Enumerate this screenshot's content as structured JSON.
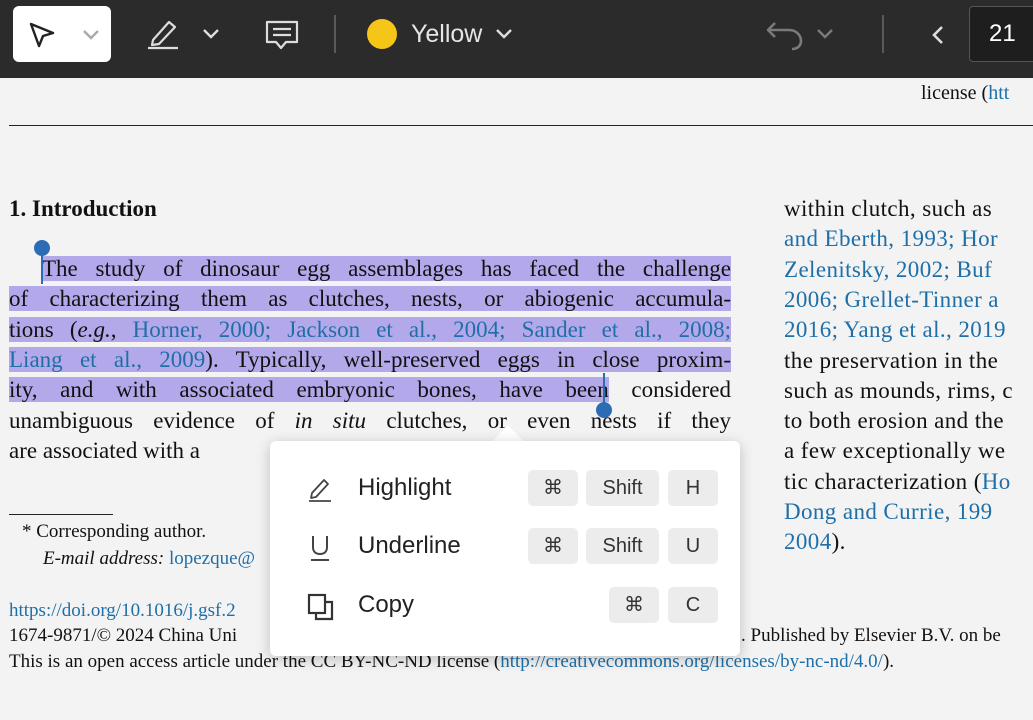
{
  "toolbar": {
    "color_label": "Yellow",
    "page_number": "21",
    "accent_color": "#f5c518"
  },
  "document": {
    "header_fragment_prefix": "license (",
    "header_fragment_link": "htt",
    "section_heading": "1. Introduction",
    "left_lines": [
      {
        "segments": [
          {
            "t": "The study of dinosaur egg assemblages has faced the challenge",
            "hl": true
          }
        ]
      },
      {
        "segments": [
          {
            "t": "of characterizing them as clutches, nests, or abiogenic accumula-",
            "hl": true
          }
        ]
      },
      {
        "segments": [
          {
            "t": "tions (",
            "hl": true
          },
          {
            "t": "e.g.",
            "hl": true,
            "i": true
          },
          {
            "t": ", ",
            "hl": true
          },
          {
            "t": "Horner, 2000; Jackson et al., 2004; Sander et al., 2008;",
            "hl": true,
            "link": true
          }
        ]
      },
      {
        "segments": [
          {
            "t": "Liang et al., 2009",
            "hl": true,
            "link": true
          },
          {
            "t": "). Typically, well-preserved eggs in close proxim-",
            "hl": true
          }
        ]
      },
      {
        "segments": [
          {
            "t": "ity, and with associated embryonic bones, have been",
            "hl": true
          },
          {
            "t": " considered"
          }
        ]
      },
      {
        "segments": [
          {
            "t": "unambiguous evidence of "
          },
          {
            "t": "in situ",
            "i": true
          },
          {
            "t": " clutches, or even nests if they"
          }
        ]
      },
      {
        "segments": [
          {
            "t": "are associated with a"
          }
        ]
      }
    ],
    "right_lines": [
      {
        "segments": [
          {
            "t": "within clutch, such as"
          }
        ]
      },
      {
        "segments": [
          {
            "t": "and Eberth, 1993; Hor",
            "link": true
          }
        ]
      },
      {
        "segments": [
          {
            "t": "Zelenitsky, 2002; Buf",
            "link": true
          }
        ]
      },
      {
        "segments": [
          {
            "t": "2006; Grellet-Tinner a",
            "link": true
          }
        ]
      },
      {
        "segments": [
          {
            "t": "2016; Yang et al., 2019",
            "link": true
          }
        ]
      },
      {
        "segments": [
          {
            "t": "the preservation in the"
          }
        ]
      },
      {
        "segments": [
          {
            "t": "such as mounds, rims, c"
          }
        ]
      },
      {
        "segments": [
          {
            "t": "to both erosion and the"
          }
        ]
      },
      {
        "segments": [
          {
            "t": "a few exceptionally we"
          }
        ]
      },
      {
        "segments": [
          {
            "t": "tic characterization ("
          },
          {
            "t": "Ho",
            "link": true
          }
        ]
      },
      {
        "segments": [
          {
            "t": "Dong and Currie, 199",
            "link": true
          }
        ]
      },
      {
        "segments": [
          {
            "t": "2004",
            "link": true
          },
          {
            "t": ")."
          }
        ]
      }
    ],
    "footnote_author": "* Corresponding author.",
    "footnote_email_label": "E-mail address:",
    "footnote_email": "lopezque@",
    "doi": "https://doi.org/10.1016/j.gsf.2",
    "copyright_left": "1674-9871/© 2024 China Uni",
    "copyright_right": ". Published by Elsevier B.V. on be",
    "license_prefix": "This is an open access article under the CC BY-NC-ND license (",
    "license_link": "http://creativecommons.org/licenses/by-nc-nd/4.0/",
    "license_suffix": ")."
  },
  "context_menu": {
    "items": [
      {
        "label": "Highlight",
        "icon": "highlighter-icon",
        "keys": [
          "⌘",
          "Shift",
          "H"
        ]
      },
      {
        "label": "Underline",
        "icon": "underline-icon",
        "keys": [
          "⌘",
          "Shift",
          "U"
        ]
      },
      {
        "label": "Copy",
        "icon": "copy-icon",
        "keys": [
          "⌘",
          "C"
        ]
      }
    ]
  }
}
